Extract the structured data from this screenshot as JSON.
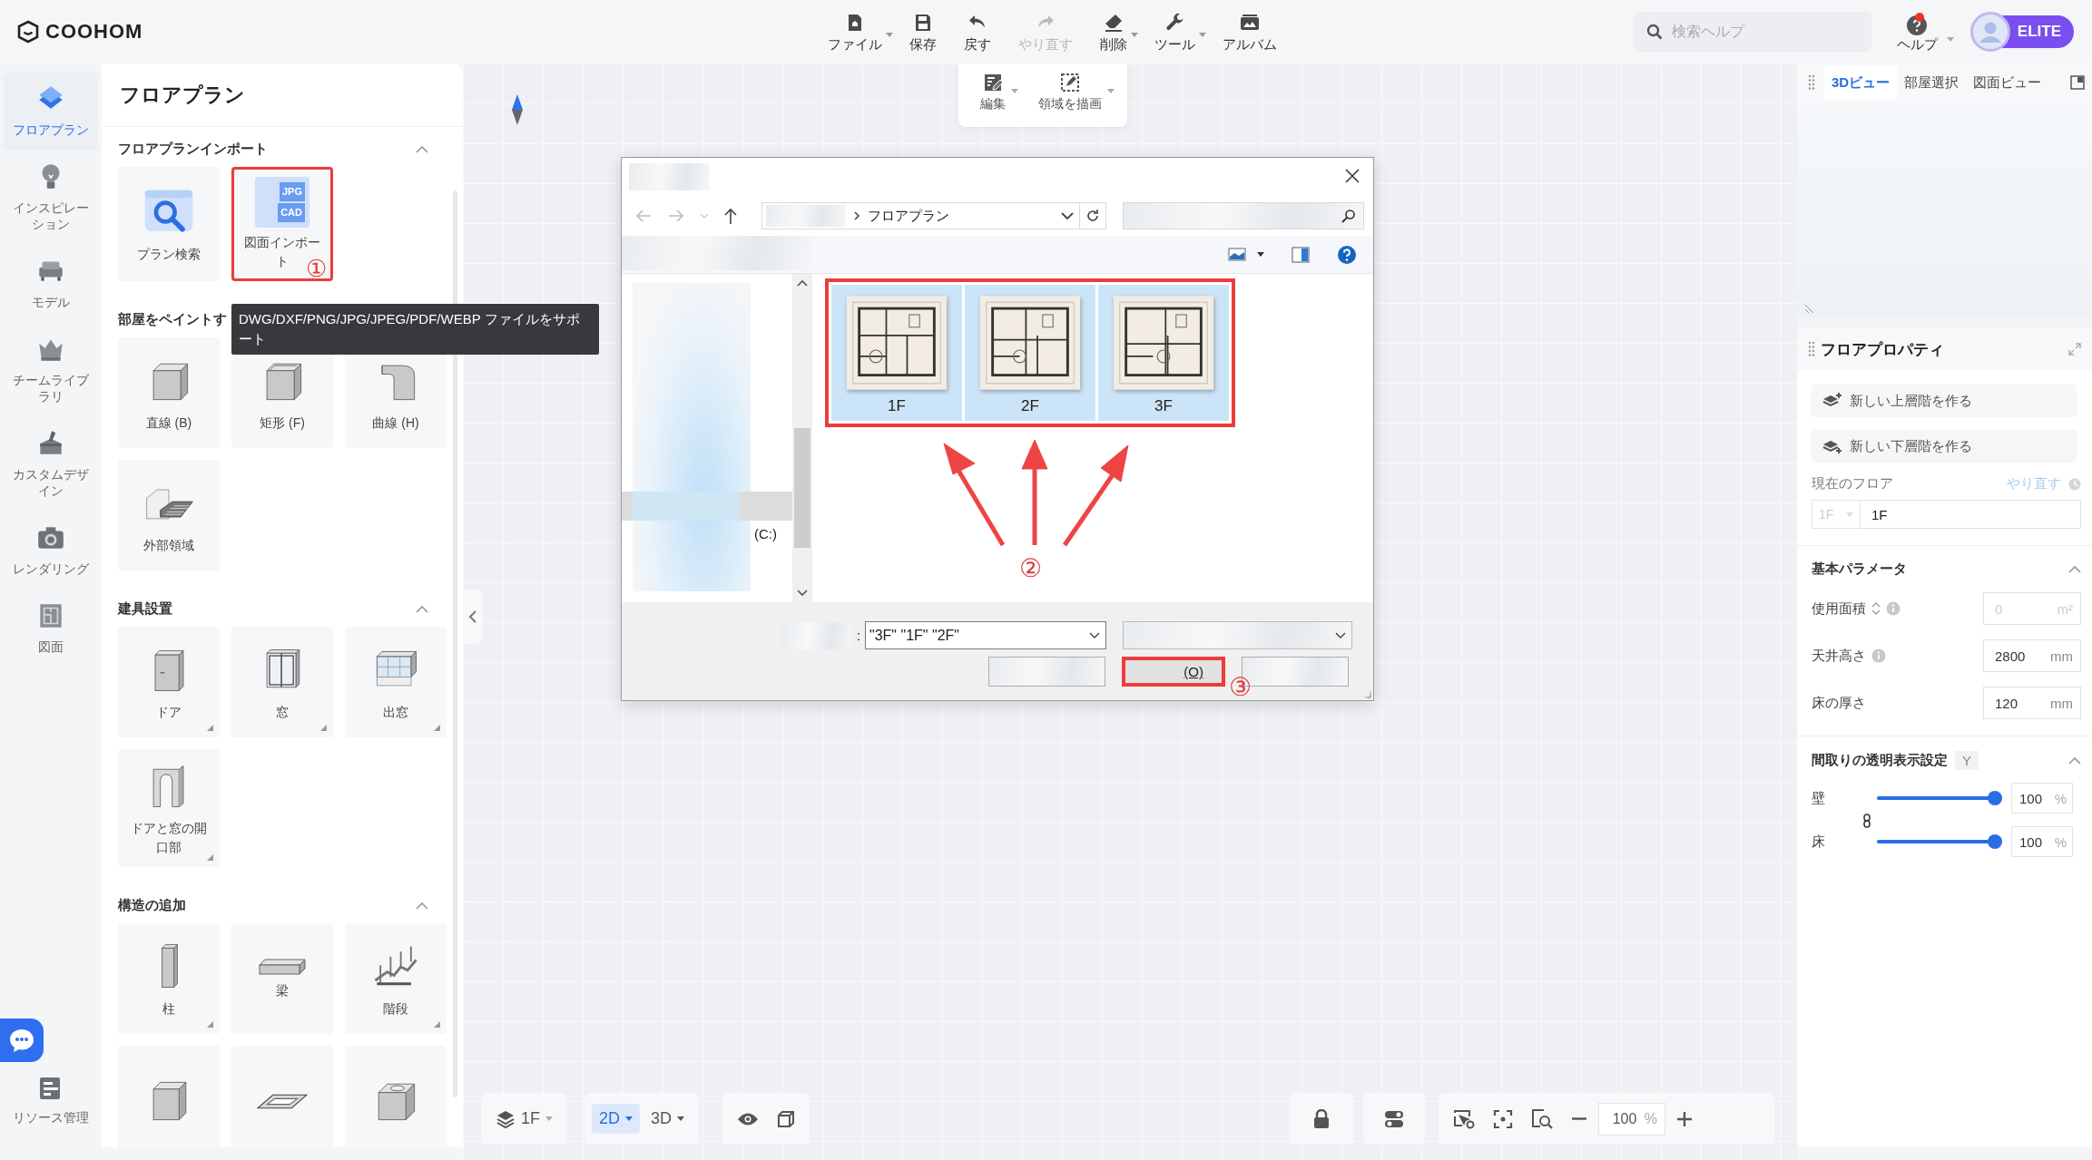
{
  "app_logo": "COOHOM",
  "toolbar": [
    {
      "label": "ファイル",
      "dropdown": true,
      "disabled": false
    },
    {
      "label": "保存",
      "dropdown": false,
      "disabled": false
    },
    {
      "label": "戻す",
      "dropdown": false,
      "disabled": false
    },
    {
      "label": "やり直す",
      "dropdown": false,
      "disabled": true
    },
    {
      "label": "削除",
      "dropdown": true,
      "disabled": false
    },
    {
      "label": "ツール",
      "dropdown": true,
      "disabled": false
    },
    {
      "label": "アルバム",
      "dropdown": false,
      "disabled": false
    }
  ],
  "search": {
    "placeholder": "検索ヘルプ"
  },
  "help": {
    "label": "ヘルプ",
    "notification": true,
    "dropdown": true
  },
  "account": {
    "badge": "ELITE"
  },
  "rail": {
    "items": [
      {
        "label": "フロアプラン",
        "selected": true
      },
      {
        "label": "インスピレーション",
        "selected": false
      },
      {
        "label": "モデル",
        "selected": false
      },
      {
        "label": "チームライブラリ",
        "selected": false
      },
      {
        "label": "カスタムデザイン",
        "selected": false
      },
      {
        "label": "レンダリング",
        "selected": false
      },
      {
        "label": "図面",
        "selected": false
      }
    ],
    "footer": {
      "label": "リソース管理"
    }
  },
  "panel": {
    "title": "フロアプラン",
    "sections": [
      {
        "title": "フロアプランインポート",
        "expanded": true,
        "items": [
          {
            "label": "プラン検索",
            "highlighted": false,
            "submenu": false
          },
          {
            "label": "図面インポート",
            "highlighted": true,
            "submenu": false,
            "badges": [
              "JPG",
              "CAD"
            ]
          }
        ]
      },
      {
        "title": "部屋をペイントす",
        "items": [
          {
            "label": "直線 (B)",
            "highlighted": false,
            "submenu": false
          },
          {
            "label": "矩形 (F)",
            "highlighted": false,
            "submenu": false
          },
          {
            "label": "曲線 (H)",
            "highlighted": false,
            "submenu": false
          },
          {
            "label": "外部領域",
            "highlighted": false,
            "submenu": false
          }
        ]
      },
      {
        "title": "建具設置",
        "expanded": true,
        "items": [
          {
            "label": "ドア",
            "highlighted": false,
            "submenu": true
          },
          {
            "label": "窓",
            "highlighted": false,
            "submenu": true
          },
          {
            "label": "出窓",
            "highlighted": false,
            "submenu": true
          },
          {
            "label": "ドアと窓の開口部",
            "highlighted": false,
            "submenu": true
          }
        ]
      },
      {
        "title": "構造の追加",
        "expanded": true,
        "items": [
          {
            "label": "柱",
            "highlighted": false,
            "submenu": true
          },
          {
            "label": "梁",
            "highlighted": false,
            "submenu": false
          },
          {
            "label": "階段",
            "highlighted": false,
            "submenu": true
          },
          {
            "highlighted": false
          },
          {
            "highlighted": false
          },
          {
            "highlighted": false
          }
        ]
      }
    ]
  },
  "tooltip": "DWG/DXF/PNG/JPG/JPEG/PDF/WEBP ファイルをサポート",
  "canvas_tools": [
    {
      "label": "編集",
      "dropdown": true
    },
    {
      "label": "領域を描画",
      "dropdown": true
    }
  ],
  "file_dialog": {
    "path": "フロアプラン",
    "drive": "(C:)",
    "files_highlighted": true,
    "files": [
      {
        "name": "1F",
        "selected": true
      },
      {
        "name": "2F",
        "selected": true
      },
      {
        "name": "3F",
        "selected": true
      }
    ],
    "name_separator": ":",
    "file_name": "\"3F\" \"1F\" \"2F\"",
    "open_button": {
      "label": "(O)",
      "highlighted": true
    }
  },
  "annotations": [
    "①",
    "②",
    "③"
  ],
  "view_tabs": [
    {
      "label": "3Dビュー",
      "selected": true
    },
    {
      "label": "部屋選択",
      "selected": false
    },
    {
      "label": "図面ビュー",
      "selected": false
    }
  ],
  "floor_properties": {
    "title": "フロアプロパティ",
    "actions": [
      "新しい上層階を作る",
      "新しい下層階を作る"
    ],
    "current_floor": {
      "label": "現在のフロア",
      "reset_link": {
        "label": "やり直す",
        "disabled": true
      },
      "floor_select": {
        "value": "1F",
        "disabled": true
      },
      "name_field": {
        "value": "1F"
      }
    },
    "sections": [
      {
        "title": "基本パラメータ",
        "expanded": true,
        "fields": [
          {
            "label": "使用面積",
            "value": "0",
            "unit": "m²",
            "disabled": true,
            "sortable": true,
            "info": true
          },
          {
            "label": "天井高さ",
            "value": "2800",
            "unit": "mm",
            "disabled": false,
            "info": true
          },
          {
            "label": "床の厚さ",
            "value": "120",
            "unit": "mm",
            "disabled": false
          }
        ]
      },
      {
        "title": "間取りの透明表示設定",
        "shortcut": "Y",
        "expanded": true,
        "linked": true,
        "sliders": [
          {
            "label": "壁",
            "level": 1,
            "value": "100",
            "unit": "%"
          },
          {
            "label": "床",
            "level": 1,
            "value": "100",
            "unit": "%"
          }
        ]
      }
    ]
  },
  "bottom_bar": {
    "floor": "1F",
    "view_modes": [
      {
        "label": "2D",
        "selected": true
      },
      {
        "label": "3D",
        "selected": false
      }
    ],
    "zoom": {
      "value": "100",
      "unit": "%"
    }
  }
}
